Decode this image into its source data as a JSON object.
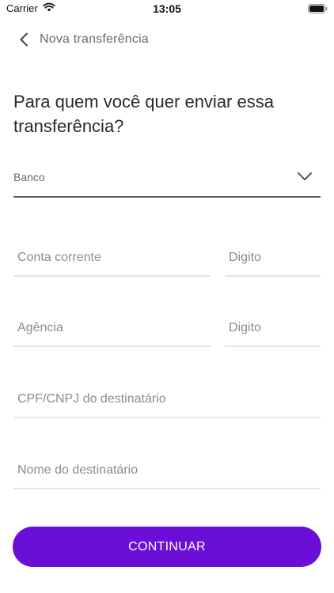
{
  "status_bar": {
    "carrier": "Carrier",
    "time": "13:05"
  },
  "header": {
    "title": "Nova transferência"
  },
  "question": "Para quem você quer enviar essa transferência?",
  "form": {
    "bank_label": "Banco",
    "conta_placeholder": "Conta corrente",
    "digito_conta_placeholder": "Digito",
    "agencia_placeholder": "Agência",
    "digito_agencia_placeholder": "Digito",
    "cpf_placeholder": "CPF/CNPJ do destinatário",
    "nome_placeholder": "Nome do destinatário"
  },
  "continue_label": "CONTINUAR",
  "colors": {
    "accent": "#6a0ed8",
    "dropdown_underline": "#5a5a6a",
    "field_underline": "#e4e4e4"
  }
}
